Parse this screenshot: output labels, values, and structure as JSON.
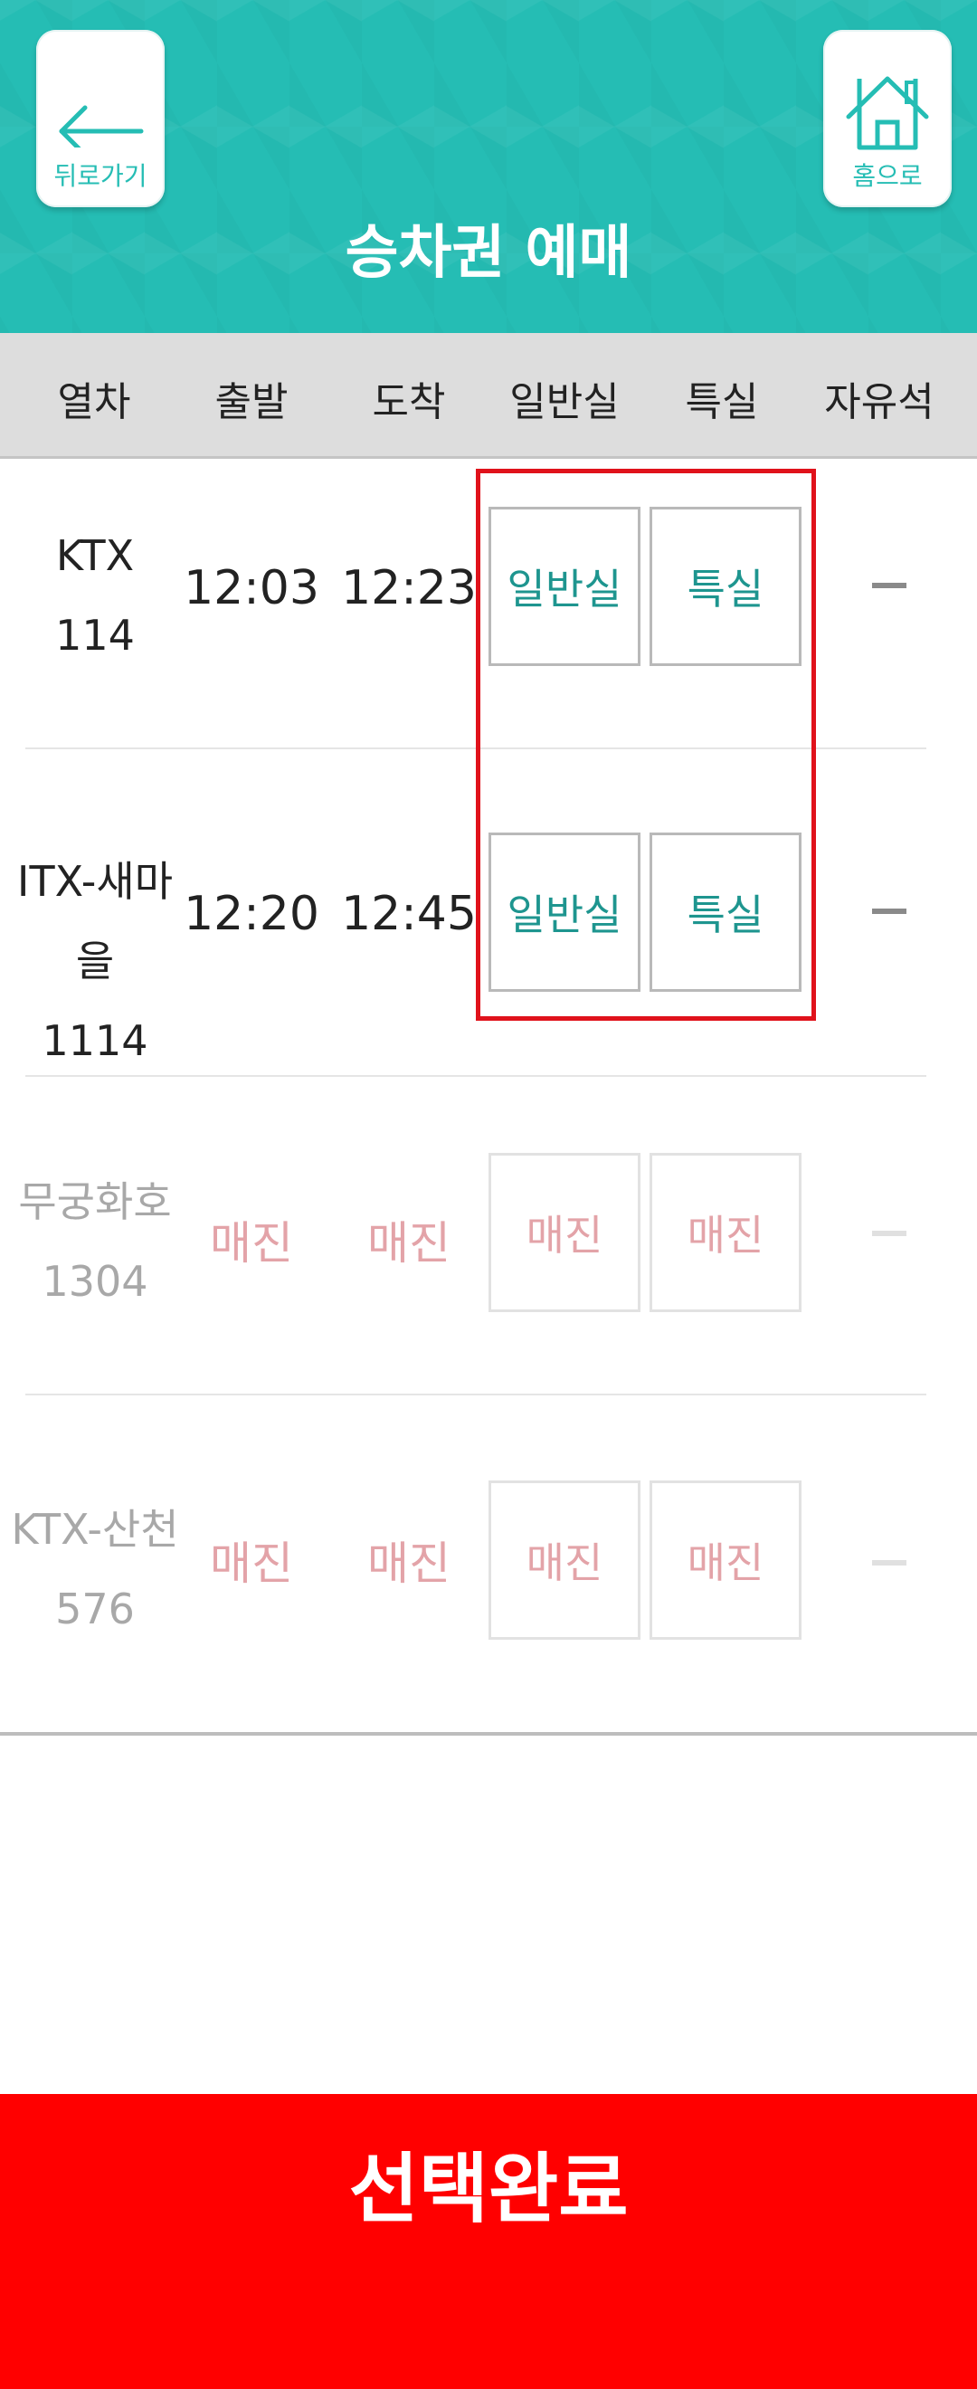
{
  "header": {
    "title": "승차권 예매",
    "back_label": "뒤로가기",
    "home_label": "홈으로",
    "color": "#25bdb4"
  },
  "columns": [
    "열차",
    "출발",
    "도착",
    "일반실",
    "특실",
    "자유석"
  ],
  "trains": [
    {
      "line1": "KTX",
      "line2": "114",
      "depart": "12:03",
      "arrive": "12:23",
      "general": "일반실",
      "first": "특실",
      "free": "—",
      "sold_out": false
    },
    {
      "line1": "ITX-새마을",
      "line2": "1114",
      "depart": "12:20",
      "arrive": "12:45",
      "general": "일반실",
      "first": "특실",
      "free": "—",
      "sold_out": false
    },
    {
      "line1": "무궁화호",
      "line2": "1304",
      "depart": "매진",
      "arrive": "매진",
      "general": "매진",
      "first": "매진",
      "free": "—",
      "sold_out": true
    },
    {
      "line1": "KTX-산천",
      "line2": "576",
      "depart": "매진",
      "arrive": "매진",
      "general": "매진",
      "first": "매진",
      "free": "—",
      "sold_out": true
    }
  ],
  "confirm_label": "선택완료",
  "colors": {
    "accent": "#25bdb4",
    "seat_text": "#1e958f",
    "sold_out": "#e3a3a8",
    "highlight": "#e0121b",
    "confirm": "#ff0000"
  }
}
